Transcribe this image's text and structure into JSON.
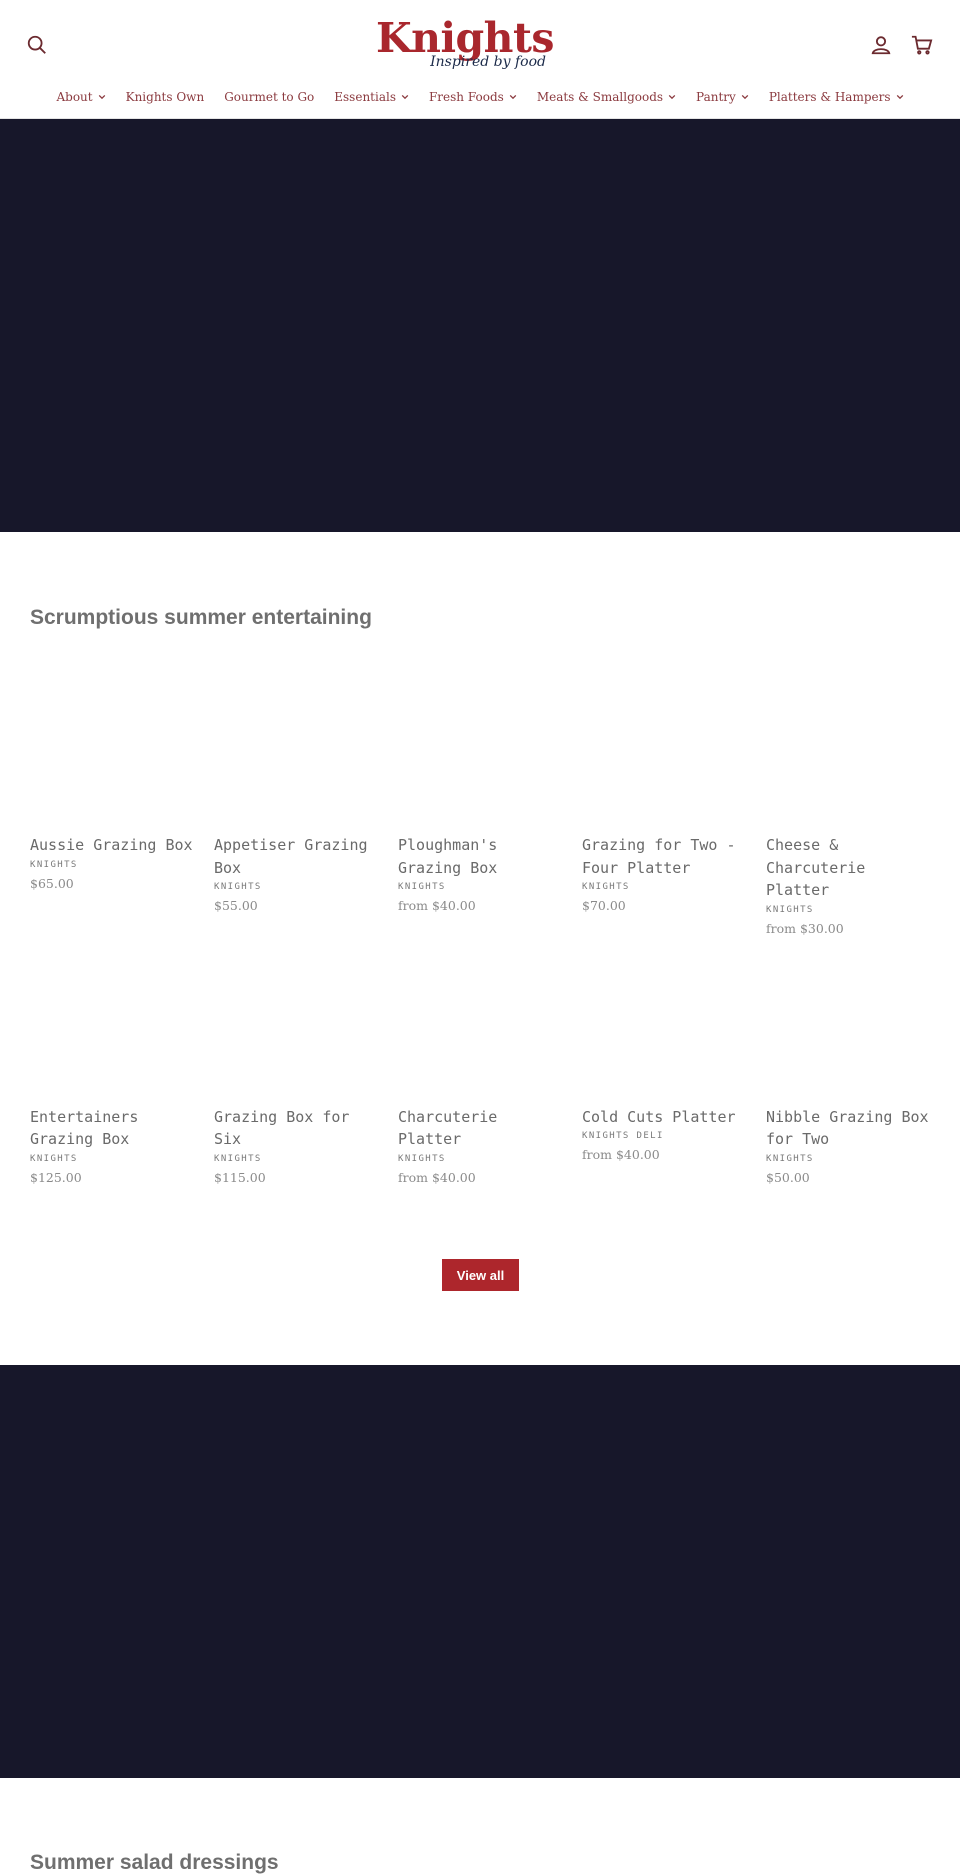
{
  "header": {
    "logo_text": "Knights",
    "logo_tagline": "Inspired by food",
    "search_icon": "search-icon",
    "account_icon": "user-icon",
    "cart_icon": "cart-icon"
  },
  "nav": {
    "items": [
      {
        "label": "About",
        "has_dropdown": true
      },
      {
        "label": "Knights Own",
        "has_dropdown": false
      },
      {
        "label": "Gourmet to Go",
        "has_dropdown": false
      },
      {
        "label": "Essentials",
        "has_dropdown": true
      },
      {
        "label": "Fresh Foods",
        "has_dropdown": true
      },
      {
        "label": "Meats & Smallgoods",
        "has_dropdown": true
      },
      {
        "label": "Pantry",
        "has_dropdown": true
      },
      {
        "label": "Platters & Hampers",
        "has_dropdown": true
      }
    ]
  },
  "colors": {
    "brand_red": "#ad262c",
    "banner_navy": "#17172a",
    "nav_text": "#8b3a3f"
  },
  "featured": {
    "title": "Scrumptious summer entertaining",
    "products": [
      {
        "title": "Aussie Grazing Box",
        "vendor": "KNIGHTS",
        "price": "$65.00"
      },
      {
        "title": "Appetiser Grazing Box",
        "vendor": "KNIGHTS",
        "price": "$55.00"
      },
      {
        "title": "Ploughman's Grazing Box",
        "vendor": "KNIGHTS",
        "price": "from $40.00"
      },
      {
        "title": "Grazing for Two - Four Platter",
        "vendor": "KNIGHTS",
        "price": "$70.00"
      },
      {
        "title": "Cheese & Charcuterie Platter",
        "vendor": "KNIGHTS",
        "price": "from $30.00"
      },
      {
        "title": "Entertainers Grazing Box",
        "vendor": "KNIGHTS",
        "price": "$125.00"
      },
      {
        "title": "Grazing Box for Six",
        "vendor": "KNIGHTS",
        "price": "$115.00"
      },
      {
        "title": "Charcuterie Platter",
        "vendor": "KNIGHTS",
        "price": "from $40.00"
      },
      {
        "title": "Cold Cuts Platter",
        "vendor": "KNIGHTS DELI",
        "price": "from $40.00"
      },
      {
        "title": "Nibble Grazing Box for Two",
        "vendor": "KNIGHTS",
        "price": "$50.00"
      }
    ],
    "view_all_label": "View all"
  },
  "second_section": {
    "title": "Summer salad dressings"
  }
}
